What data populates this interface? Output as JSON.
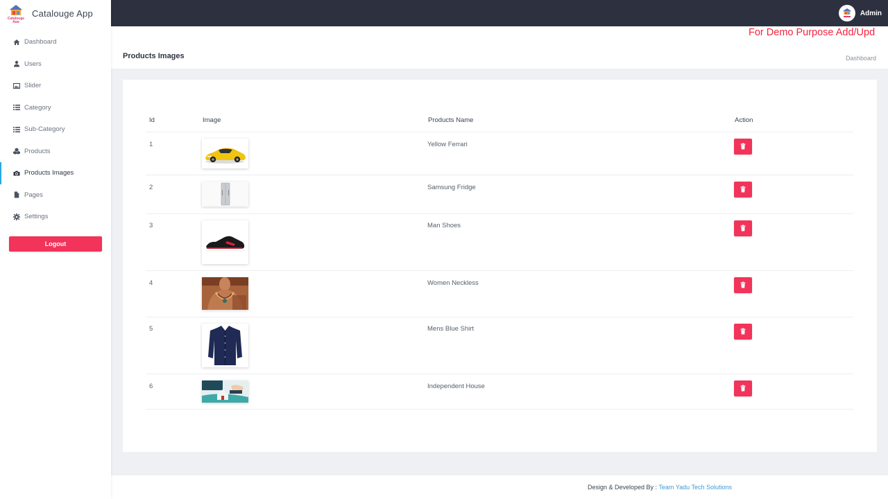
{
  "brand": {
    "name": "Catalouge App",
    "logo_text": "Catalouge App"
  },
  "sidebar": {
    "items": [
      {
        "label": "Dashboard",
        "icon": "home-icon"
      },
      {
        "label": "Users",
        "icon": "user-icon"
      },
      {
        "label": "Slider",
        "icon": "image-icon"
      },
      {
        "label": "Category",
        "icon": "list-icon"
      },
      {
        "label": "Sub-Category",
        "icon": "list-icon"
      },
      {
        "label": "Products",
        "icon": "cubes-icon"
      },
      {
        "label": "Products Images",
        "icon": "camera-icon",
        "active": true
      },
      {
        "label": "Pages",
        "icon": "file-icon"
      },
      {
        "label": "Settings",
        "icon": "gear-icon"
      }
    ],
    "logout_label": "Logout"
  },
  "topbar": {
    "user_name": "Admin"
  },
  "header": {
    "notice": "For Demo Purpose Add/Upd",
    "title": "Products Images",
    "breadcrumb": "Dashboard"
  },
  "table": {
    "columns": [
      "Id",
      "Image",
      "Products Name",
      "Action"
    ],
    "rows": [
      {
        "id": "1",
        "name": "Yellow Ferrari",
        "image": "car"
      },
      {
        "id": "2",
        "name": "Samsung Fridge",
        "image": "fridge"
      },
      {
        "id": "3",
        "name": "Man Shoes",
        "image": "shoe"
      },
      {
        "id": "4",
        "name": "Women Neckless",
        "image": "necklace"
      },
      {
        "id": "5",
        "name": "Mens Blue Shirt",
        "image": "shirt"
      },
      {
        "id": "6",
        "name": "Independent House",
        "image": "house"
      }
    ],
    "delete_icon": "trash-icon"
  },
  "footer": {
    "prefix": "Design & Developed By : ",
    "link": "Team Yadu Tech Solutions"
  },
  "colors": {
    "accent": "#f2335a",
    "topbar": "#2c303f",
    "active_bar": "#27a9e1",
    "link": "#3b9ad9",
    "notice": "#f2233f"
  }
}
